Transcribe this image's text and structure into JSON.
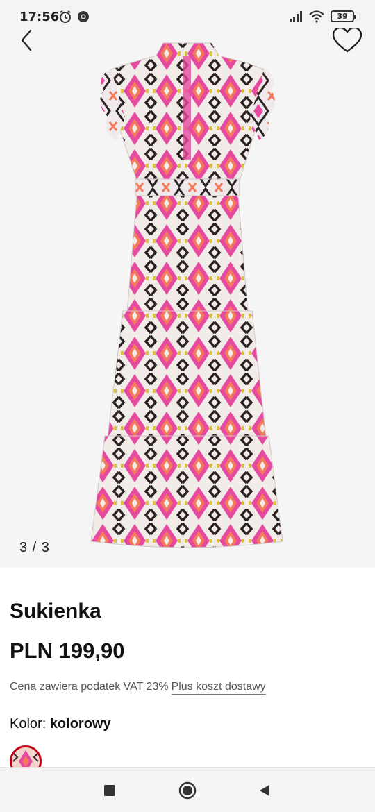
{
  "status_bar": {
    "time": "17:56",
    "battery": "39",
    "icons": [
      "alarm-icon",
      "chrome-icon",
      "signal-icon",
      "wifi-icon",
      "battery-icon"
    ]
  },
  "gallery": {
    "counter": "3 / 3",
    "back_icon": "chevron-left-icon",
    "favorite_icon": "heart-outline-icon",
    "image": "patterned-maxi-dress"
  },
  "product": {
    "name": "Sukienka",
    "price": "PLN 199,90",
    "vat_text": "Cena zawiera podatek VAT 23%",
    "shipping_link": "Plus koszt dostawy",
    "color_label": "Kolor:",
    "color_value": "kolorowy"
  },
  "nav_bar": {
    "icons": [
      "recent-apps-icon",
      "home-icon",
      "back-icon"
    ]
  },
  "colors": {
    "accent": "#c2001a",
    "dress_pink": "#e64aa0",
    "dress_coral": "#f47a5a",
    "dress_dark": "#2b2222"
  }
}
